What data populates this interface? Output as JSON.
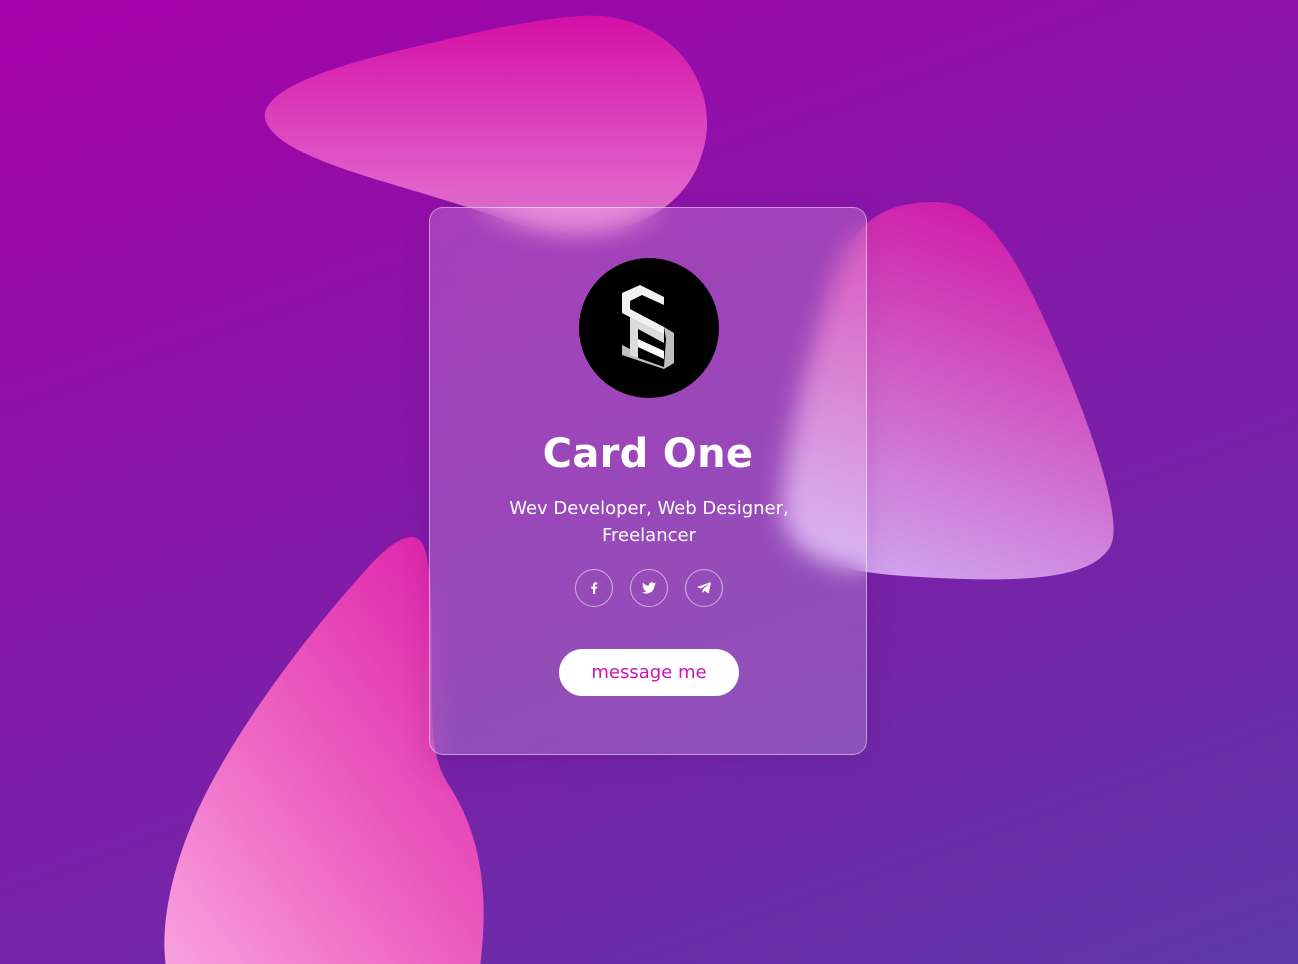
{
  "card": {
    "title": "Card One",
    "subtitle": "Wev Developer, Web Designer, Freelancer",
    "avatar_icon": "brand-logo-icon",
    "socials": [
      {
        "icon": "facebook-icon",
        "glyph": "f"
      },
      {
        "icon": "twitter-icon"
      },
      {
        "icon": "telegram-icon"
      }
    ],
    "button_label": "message me"
  },
  "colors": {
    "background_start": "#a600a9",
    "background_end": "#5f37aa",
    "blob_pink": "#e22ab4",
    "blob_light": "#d2a8f0",
    "button_text": "#c912b8"
  }
}
